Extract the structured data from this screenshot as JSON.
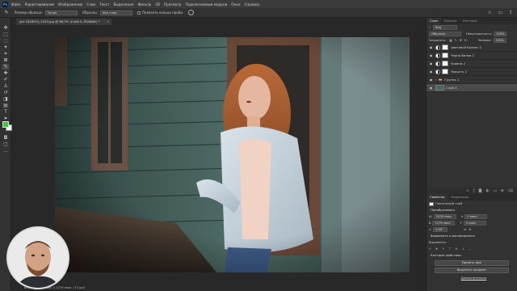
{
  "menu": {
    "logo": "Ps",
    "items": [
      "Файл",
      "Редактирование",
      "Изображение",
      "Слои",
      "Текст",
      "Выделение",
      "Фильтр",
      "3D",
      "Просмотр",
      "Подключаемые модули",
      "Окно",
      "Справка"
    ]
  },
  "options": {
    "size_label": "Размер образца:",
    "size_value": "Точка",
    "sample_label": "Образец:",
    "sample_value": "Все слои",
    "show_ring_label": "Показать кольцо пробы"
  },
  "document": {
    "tab_title": "girl-1828524_1920.jpg @ 66,7% (Слой 0, RGB/8#) *",
    "status": "66,67%   1920 пикс. x 1279 пикс. (72 ppi)"
  },
  "colors": {
    "foreground": "#3ec83a",
    "background": "#ffffff"
  },
  "layers_panel": {
    "tabs": [
      "Слои",
      "Каналы",
      "Контуры"
    ],
    "search_label": "Вид",
    "blend_mode": "Обычные",
    "opacity_label": "Непрозрачность:",
    "opacity_value": "100%",
    "lock_label": "Закрепить:",
    "fill_label": "Заливка:",
    "fill_value": "100%",
    "layers": [
      {
        "name": "Цветовой баланс 2",
        "type": "adjustment"
      },
      {
        "name": "Черно-белое 2",
        "type": "adjustment"
      },
      {
        "name": "Уровни 2",
        "type": "adjustment"
      },
      {
        "name": "Яркость 2",
        "type": "adjustment"
      },
      {
        "name": "Группа 1",
        "type": "group"
      },
      {
        "name": "Слой 0",
        "type": "pixel",
        "active": true
      }
    ]
  },
  "properties_panel": {
    "tabs": [
      "Свойства",
      "Коррекция"
    ],
    "layer_kind": "Пиксельный слой",
    "transform_title": "Преобразовать",
    "w_label": "Ш",
    "w_value": "2035 пикс.",
    "h_label": "В",
    "h_value": "1279 пикс.",
    "x_label": "X",
    "x_value": "0 пикс.",
    "y_label": "Y",
    "y_value": "0 пикс.",
    "angle_value": "0,00°",
    "align_title": "Выровнять и распределить",
    "align_label": "Выровнять:",
    "quick_actions_title": "Быстрые действия",
    "remove_bg": "Удалить фон",
    "select_subject": "Выделить предмет",
    "more_link": "Дополнительно"
  }
}
